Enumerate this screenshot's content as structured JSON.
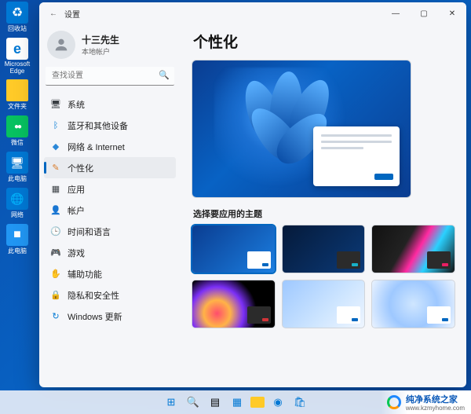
{
  "desktop_icons": [
    {
      "name": "recycle",
      "label": "回收站"
    },
    {
      "name": "edge",
      "label": "Microsoft Edge"
    },
    {
      "name": "folder",
      "label": "文件夹"
    },
    {
      "name": "wechat",
      "label": "微信"
    },
    {
      "name": "thispc",
      "label": "此电脑"
    },
    {
      "name": "net",
      "label": "网络"
    },
    {
      "name": "blu",
      "label": "此电脑"
    }
  ],
  "window": {
    "app_title": "设置",
    "back_glyph": "←",
    "min_glyph": "—",
    "max_glyph": "▢",
    "close_glyph": "✕"
  },
  "user": {
    "name": "十三先生",
    "type": "本地帐户"
  },
  "search": {
    "placeholder": "查找设置",
    "icon": "🔍"
  },
  "nav": {
    "items": [
      {
        "icon": "🖥",
        "label": "系统",
        "color": "#3a3f44"
      },
      {
        "icon": "ᛒ",
        "label": "蓝牙和其他设备",
        "color": "#0078d4"
      },
      {
        "icon": "◆",
        "label": "网络 & Internet",
        "color": "#2b88d8"
      },
      {
        "icon": "✎",
        "label": "个性化",
        "color": "#d97b29",
        "active": true
      },
      {
        "icon": "▦",
        "label": "应用",
        "color": "#3a3f44"
      },
      {
        "icon": "👤",
        "label": "帐户",
        "color": "#3a8f3a"
      },
      {
        "icon": "🕒",
        "label": "时间和语言",
        "color": "#3a3f44"
      },
      {
        "icon": "🎮",
        "label": "游戏",
        "color": "#3a3f44"
      },
      {
        "icon": "✋",
        "label": "辅助功能",
        "color": "#1a73e8"
      },
      {
        "icon": "🔒",
        "label": "隐私和安全性",
        "color": "#3a3f44"
      },
      {
        "icon": "↻",
        "label": "Windows 更新",
        "color": "#0078d4"
      }
    ]
  },
  "main": {
    "title": "个性化",
    "section_label": "选择要应用的主题",
    "themes": [
      {
        "cls": "t0",
        "accent": "blue",
        "dark": false,
        "selected": true
      },
      {
        "cls": "t1",
        "accent": "cyan",
        "dark": true,
        "selected": false
      },
      {
        "cls": "t2",
        "accent": "pink",
        "dark": true,
        "selected": false
      },
      {
        "cls": "t3",
        "accent": "red",
        "dark": true,
        "selected": false
      },
      {
        "cls": "t4",
        "accent": "lt",
        "dark": false,
        "selected": false
      },
      {
        "cls": "t5",
        "accent": "lt",
        "dark": false,
        "selected": false
      }
    ]
  },
  "brand": {
    "text": "纯净系统之家",
    "url": "www.kzmyhome.com"
  },
  "colors": {
    "accent": "#0067c0"
  }
}
